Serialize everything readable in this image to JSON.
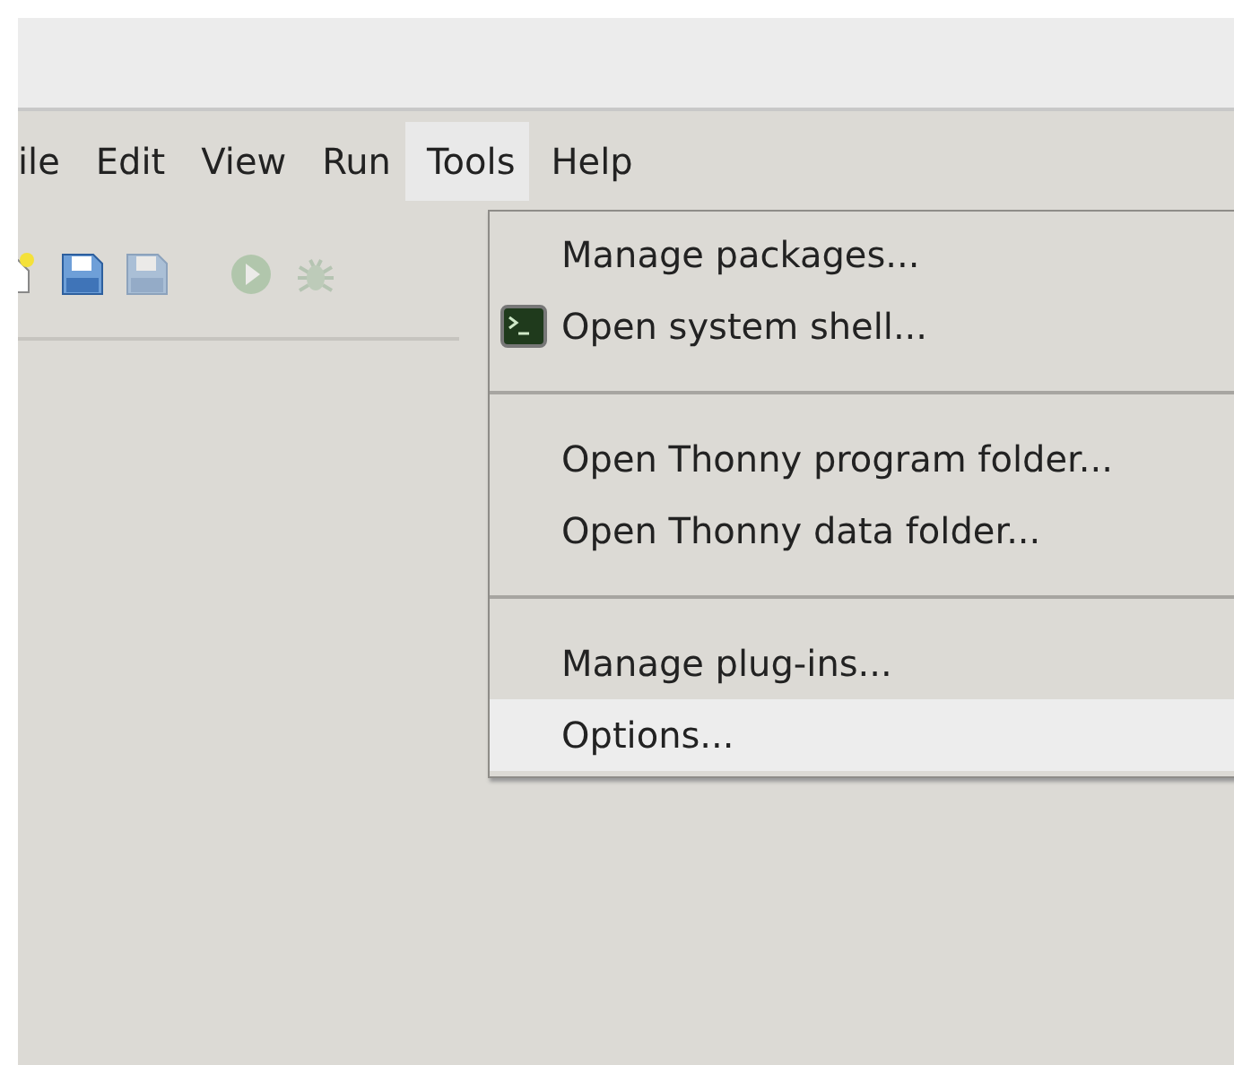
{
  "menubar": [
    {
      "label": "ile",
      "selected": false
    },
    {
      "label": "Edit",
      "selected": false
    },
    {
      "label": "View",
      "selected": false
    },
    {
      "label": "Run",
      "selected": false
    },
    {
      "label": "Tools",
      "selected": true
    },
    {
      "label": "Help",
      "selected": false
    }
  ],
  "toolbar": [
    {
      "kind": "new",
      "disabled": false
    },
    {
      "kind": "save",
      "disabled": false
    },
    {
      "kind": "save",
      "disabled": true
    },
    {
      "kind": "gap"
    },
    {
      "kind": "run",
      "disabled": true
    },
    {
      "kind": "debug",
      "disabled": true
    }
  ],
  "menu": {
    "items": [
      {
        "kind": "item",
        "label": "Manage packages...",
        "selected": false
      },
      {
        "kind": "terminal-item",
        "label": "Open system shell...",
        "selected": false
      },
      {
        "kind": "separator"
      },
      {
        "kind": "item",
        "label": "Open Thonny program folder...",
        "selected": false
      },
      {
        "kind": "item",
        "label": "Open Thonny data folder...",
        "selected": false
      },
      {
        "kind": "separator"
      },
      {
        "kind": "item",
        "label": "Manage plug-ins...",
        "selected": false
      },
      {
        "kind": "item",
        "label": "Options...",
        "selected": true
      }
    ]
  }
}
